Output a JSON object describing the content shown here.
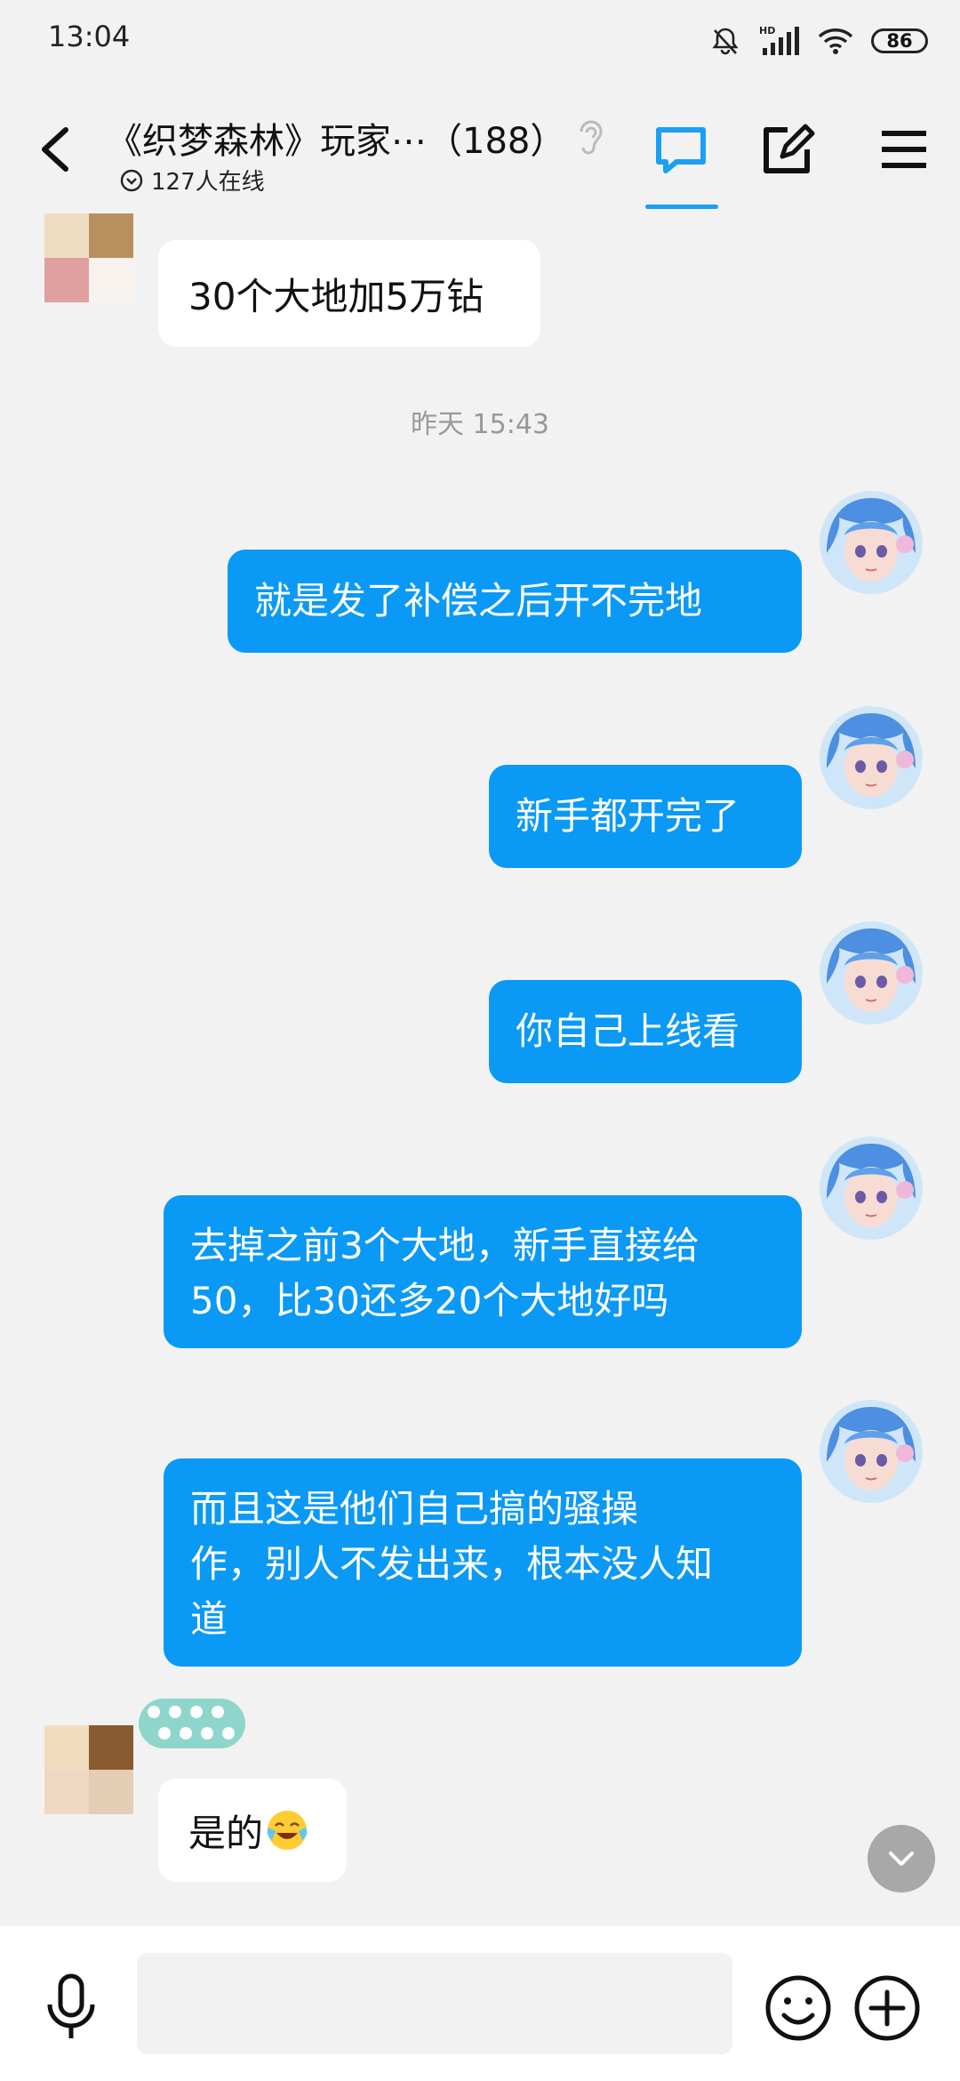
{
  "status_bar": {
    "time": "13:04",
    "battery": "86",
    "network_label": "HD"
  },
  "header": {
    "title": "《织梦森林》玩家⋯（188）",
    "online": "127人在线"
  },
  "messages": {
    "m1": "30个大地加5万钻",
    "timestamp": "昨天 15:43",
    "m2": "就是发了补偿之后开不完地",
    "m3": "新手都开完了",
    "m4": "你自己上线看",
    "m5_line1": "去掉之前3个大地，新手直接给",
    "m5_line2": "50，比30还多20个大地好吗",
    "m6_line1": "而且这是他们自己搞的骚操",
    "m6_line2": "作，别人不发出来，根本没人知",
    "m6_line3": "道",
    "m7": "是的"
  },
  "composer": {
    "placeholder": ""
  },
  "colors": {
    "outgoing_bubble": "#0a99f5",
    "accent": "#1aa0f2",
    "background": "#f2f2f2"
  }
}
